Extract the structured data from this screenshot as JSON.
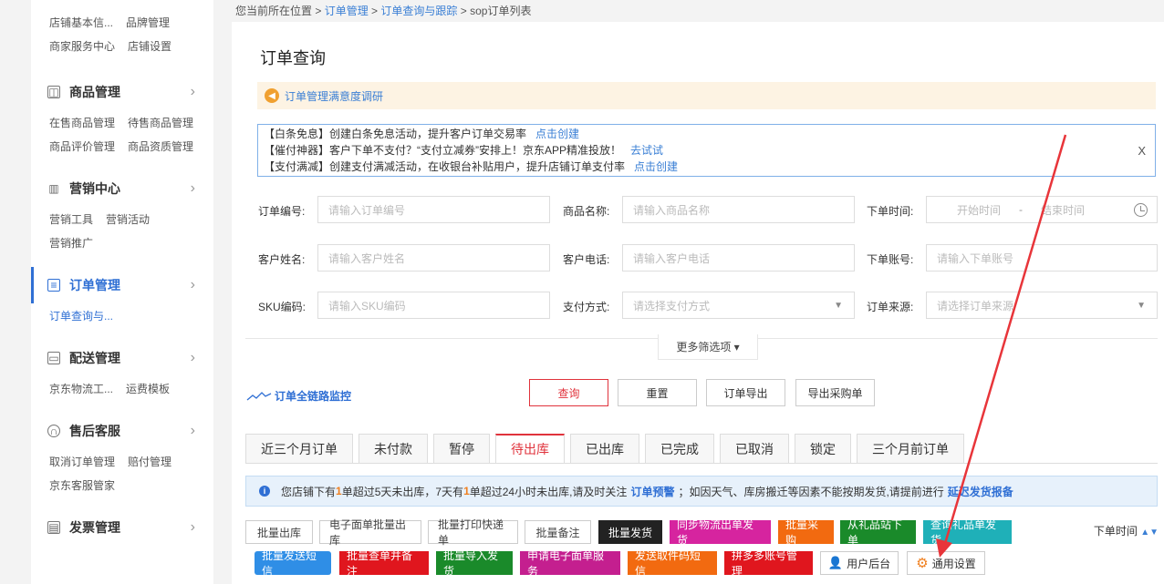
{
  "sidebar": {
    "top_links": [
      [
        "店铺基本信...",
        "品牌管理"
      ],
      [
        "商家服务中心",
        "店铺设置"
      ]
    ],
    "sections": [
      {
        "title": "商品管理",
        "links": [
          [
            "在售商品管理",
            "待售商品管理"
          ],
          [
            "商品评价管理",
            "商品资质管理"
          ]
        ]
      },
      {
        "title": "营销中心",
        "links": [
          [
            "营销工具",
            "营销活动"
          ],
          [
            "营销推广"
          ]
        ]
      },
      {
        "title": "订单管理",
        "active": true,
        "links": [
          [
            "订单查询与..."
          ]
        ]
      },
      {
        "title": "配送管理",
        "links": [
          [
            "京东物流工...",
            "运费模板"
          ]
        ]
      },
      {
        "title": "售后客服",
        "links": [
          [
            "取消订单管理",
            "赔付管理"
          ],
          [
            "京东客服管家"
          ]
        ]
      },
      {
        "title": "发票管理",
        "links": []
      }
    ]
  },
  "breadcrumb": {
    "prefix": "您当前所在位置 >",
    "items": [
      "订单管理",
      "订单查询与跟踪"
    ],
    "current": "sop订单列表",
    "sep": ">"
  },
  "page": {
    "title": "订单查询",
    "survey": "订单管理满意度调研",
    "notices": [
      {
        "text": "【白条免息】创建白条免息活动，提升客户订单交易率",
        "link": "点击创建"
      },
      {
        "text": "【催付神器】客户下单不支付？“支付立减券”安排上！京东APP精准投放！",
        "link": "去试试"
      },
      {
        "text": "【支付满减】创建支付满减活动，在收银台补贴用户，提升店铺订单支付率",
        "link": "点击创建"
      }
    ],
    "notice_close": "X"
  },
  "form": {
    "order_no": {
      "label": "订单编号:",
      "placeholder": "请输入订单编号"
    },
    "product_name": {
      "label": "商品名称:",
      "placeholder": "请输入商品名称"
    },
    "order_time": {
      "label": "下单时间:",
      "start": "开始时间",
      "sep": "-",
      "end": "结束时间"
    },
    "customer_name": {
      "label": "客户姓名:",
      "placeholder": "请输入客户姓名"
    },
    "customer_phone": {
      "label": "客户电话:",
      "placeholder": "请输入客户电话"
    },
    "account": {
      "label": "下单账号:",
      "placeholder": "请输入下单账号"
    },
    "sku": {
      "label": "SKU编码:",
      "placeholder": "请输入SKU编码"
    },
    "pay_method": {
      "label": "支付方式:",
      "placeholder": "请选择支付方式"
    },
    "order_source": {
      "label": "订单来源:",
      "placeholder": "请选择订单来源"
    },
    "more_filters": "更多筛选项 ▾"
  },
  "actions": {
    "monitor": "订单全链路监控",
    "query": "查询",
    "reset": "重置",
    "export": "订单导出",
    "export_purchase": "导出采购单"
  },
  "tabs": [
    "近三个月订单",
    "未付款",
    "暂停",
    "待出库",
    "已出库",
    "已完成",
    "已取消",
    "锁定",
    "三个月前订单"
  ],
  "active_tab": 3,
  "alert": {
    "p1": "您店铺下有",
    "n1": "1",
    "p2": "单超过5天未出库，7天有",
    "n2": "1",
    "p3": "单超过24小时未出库,请及时关注",
    "link1": "订单预警",
    "p4": "；如因天气、库房搬迁等因素不能按期发货,请提前进行",
    "link2": "延迟发货报备"
  },
  "batch_row1": [
    "批量出库",
    "电子面单批量出库",
    "批量打印快递单",
    "批量备注"
  ],
  "color_row1": [
    {
      "label": "批量发货",
      "color": "#222222"
    },
    {
      "label": "同步物流出单发货",
      "color": "#d6249f"
    },
    {
      "label": "批量采购",
      "color": "#f26a10"
    },
    {
      "label": "从礼品站下单",
      "color": "#1a8a2a"
    },
    {
      "label": "查询礼品单发货",
      "color": "#1fb0b8"
    }
  ],
  "sort_label": "下单时间",
  "color_row2": [
    {
      "label": "批量发送短信",
      "color": "#2f8ee6"
    },
    {
      "label": "批量查单并备注",
      "color": "#e0161e"
    },
    {
      "label": "批量导入发货",
      "color": "#1a8a2a"
    },
    {
      "label": "申请电子面单服务",
      "color": "#c41f8f"
    },
    {
      "label": "发送取件码短信",
      "color": "#f26a10"
    },
    {
      "label": "拼多多账号管理",
      "color": "#e0161e"
    }
  ],
  "user_backend": "用户后台",
  "general_settings": "通用设置"
}
